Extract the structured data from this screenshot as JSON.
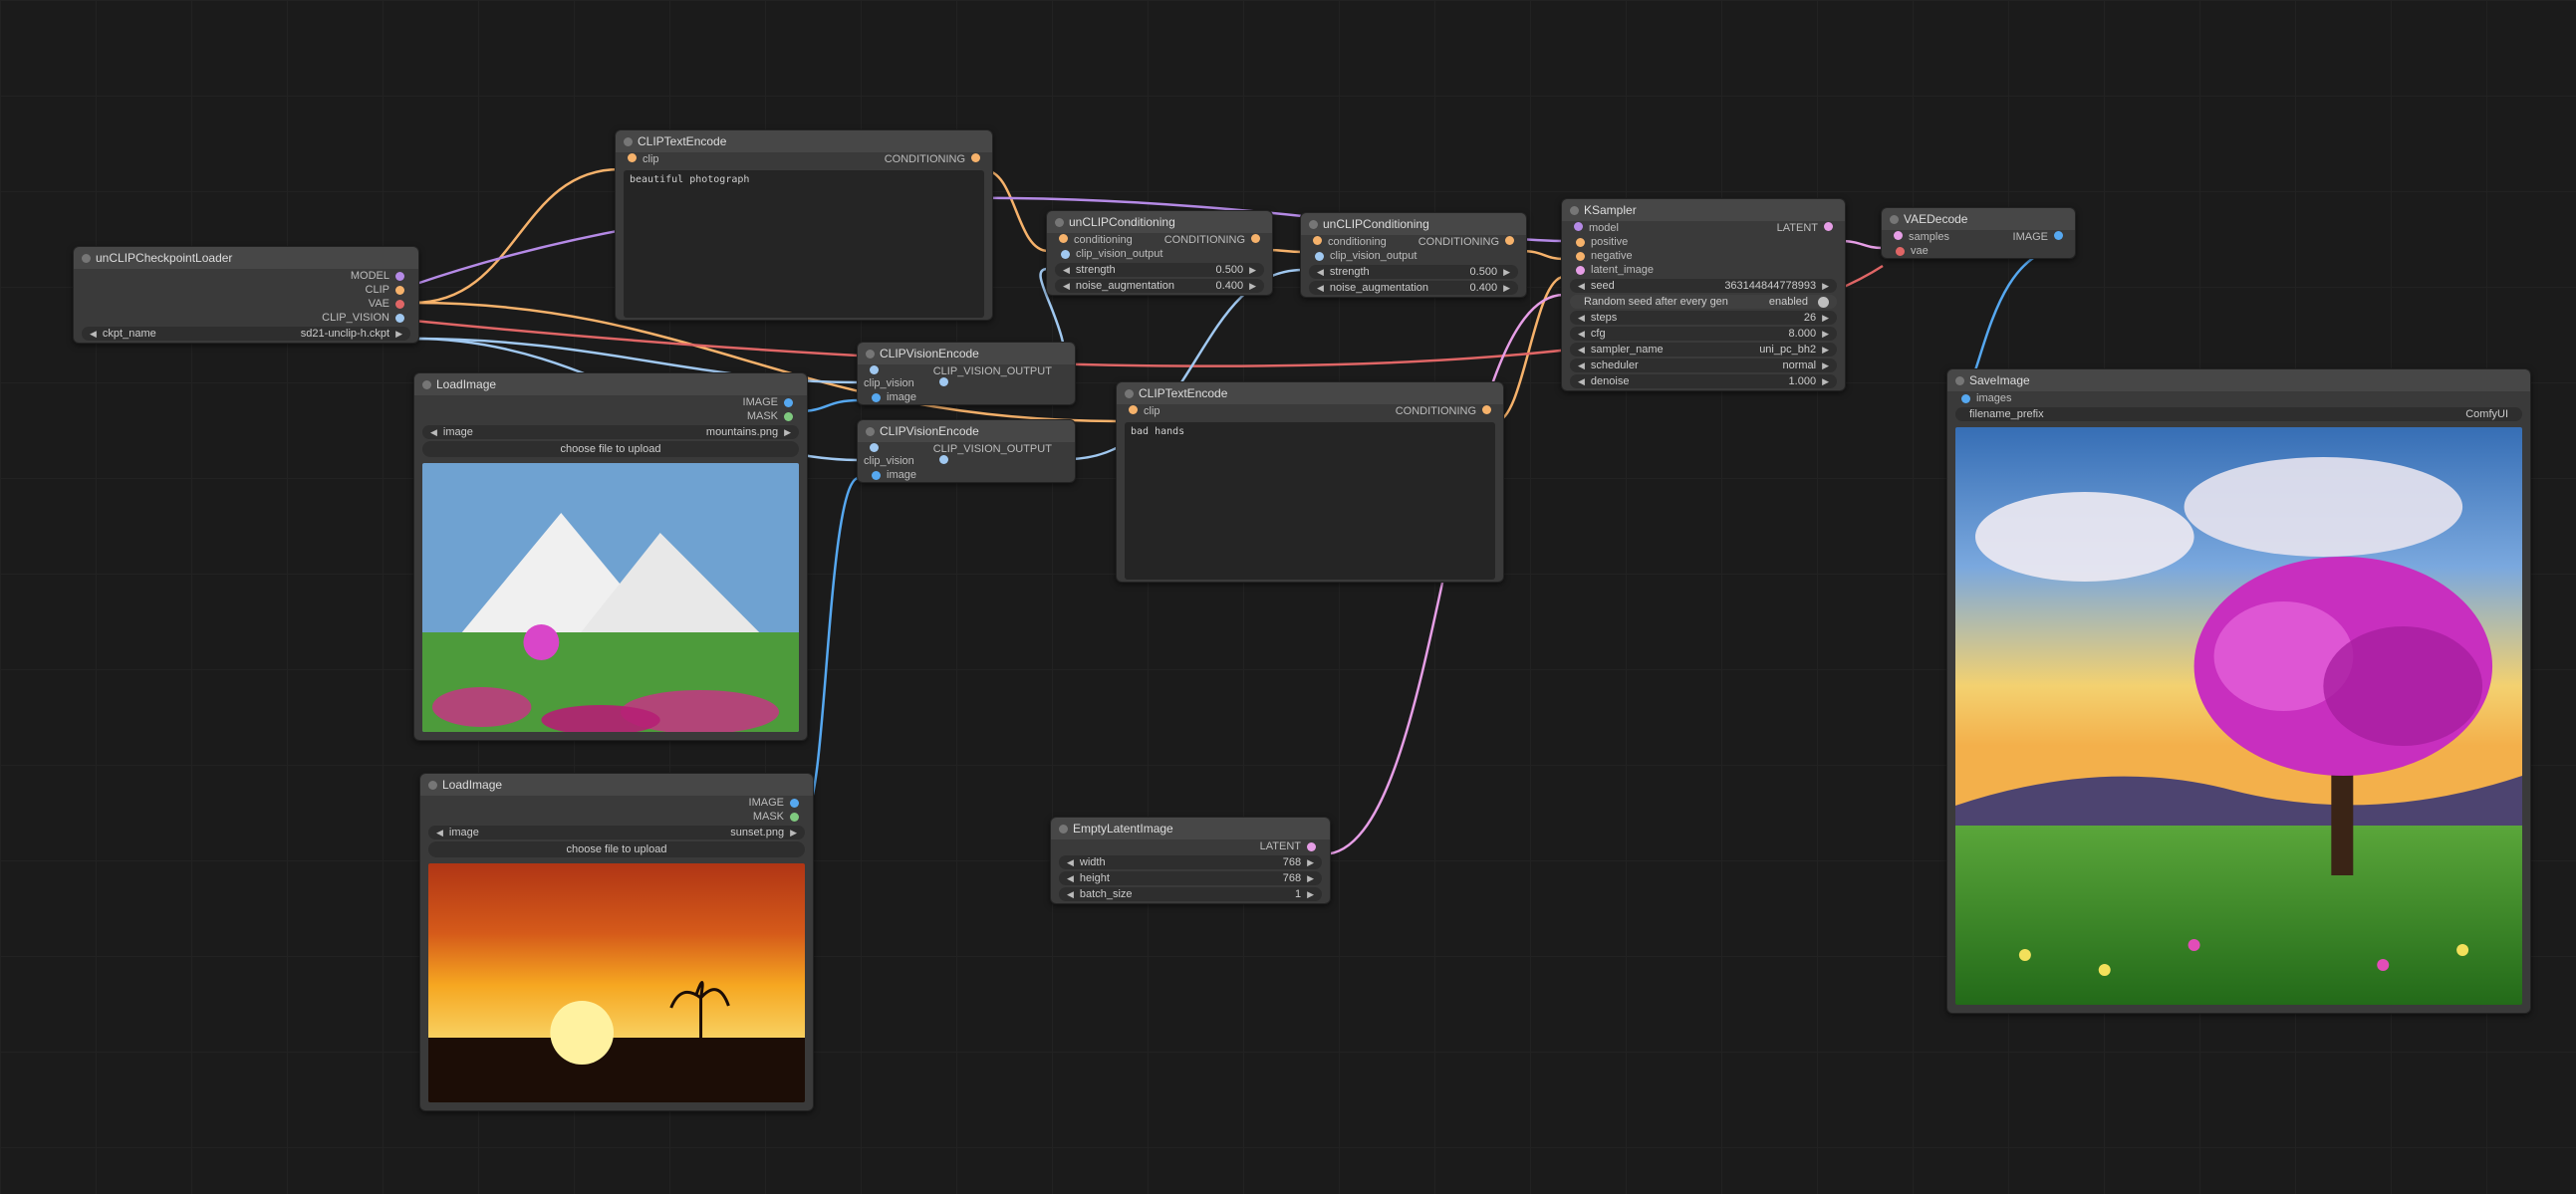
{
  "nodes": {
    "ckpt": {
      "title": "unCLIPCheckpointLoader",
      "outputs": [
        "MODEL",
        "CLIP",
        "VAE",
        "CLIP_VISION"
      ],
      "widgets": {
        "ckpt_name": {
          "label": "ckpt_name",
          "value": "sd21-unclip-h.ckpt"
        }
      }
    },
    "cliptext_pos": {
      "title": "CLIPTextEncode",
      "inputs": {
        "clip": "clip"
      },
      "outputs": [
        "CONDITIONING"
      ],
      "text": "beautiful photograph"
    },
    "cliptext_neg": {
      "title": "CLIPTextEncode",
      "inputs": {
        "clip": "clip"
      },
      "outputs": [
        "CONDITIONING"
      ],
      "text": "bad hands"
    },
    "loadimg1": {
      "title": "LoadImage",
      "outputs": [
        "IMAGE",
        "MASK"
      ],
      "widgets": {
        "image": {
          "label": "image",
          "value": "mountains.png"
        }
      },
      "button": "choose file to upload"
    },
    "loadimg2": {
      "title": "LoadImage",
      "outputs": [
        "IMAGE",
        "MASK"
      ],
      "widgets": {
        "image": {
          "label": "image",
          "value": "sunset.png"
        }
      },
      "button": "choose file to upload"
    },
    "clipvis1": {
      "title": "CLIPVisionEncode",
      "inputs": {
        "clip_vision": "clip_vision",
        "image": "image"
      },
      "outputs": [
        "CLIP_VISION_OUTPUT"
      ]
    },
    "clipvis2": {
      "title": "CLIPVisionEncode",
      "inputs": {
        "clip_vision": "clip_vision",
        "image": "image"
      },
      "outputs": [
        "CLIP_VISION_OUTPUT"
      ]
    },
    "unclip1": {
      "title": "unCLIPConditioning",
      "inputs": {
        "conditioning": "conditioning",
        "cvo": "clip_vision_output"
      },
      "outputs": [
        "CONDITIONING"
      ],
      "widgets": {
        "strength": {
          "label": "strength",
          "value": "0.500"
        },
        "noise_aug": {
          "label": "noise_augmentation",
          "value": "0.400"
        }
      }
    },
    "unclip2": {
      "title": "unCLIPConditioning",
      "inputs": {
        "conditioning": "conditioning",
        "cvo": "clip_vision_output"
      },
      "outputs": [
        "CONDITIONING"
      ],
      "widgets": {
        "strength": {
          "label": "strength",
          "value": "0.500"
        },
        "noise_aug": {
          "label": "noise_augmentation",
          "value": "0.400"
        }
      }
    },
    "ksampler": {
      "title": "KSampler",
      "inputs": {
        "model": "model",
        "positive": "positive",
        "negative": "negative",
        "latent_image": "latent_image"
      },
      "outputs": [
        "LATENT"
      ],
      "widgets": {
        "seed": {
          "label": "seed",
          "value": "363144844778993"
        },
        "random_seed_toggle": {
          "label": "Random seed after every gen",
          "value": "enabled"
        },
        "steps": {
          "label": "steps",
          "value": "26"
        },
        "cfg": {
          "label": "cfg",
          "value": "8.000"
        },
        "sampler_name": {
          "label": "sampler_name",
          "value": "uni_pc_bh2"
        },
        "scheduler": {
          "label": "scheduler",
          "value": "normal"
        },
        "denoise": {
          "label": "denoise",
          "value": "1.000"
        }
      }
    },
    "empty": {
      "title": "EmptyLatentImage",
      "outputs": [
        "LATENT"
      ],
      "widgets": {
        "width": {
          "label": "width",
          "value": "768"
        },
        "height": {
          "label": "height",
          "value": "768"
        },
        "batch_size": {
          "label": "batch_size",
          "value": "1"
        }
      }
    },
    "vaedecode": {
      "title": "VAEDecode",
      "inputs": {
        "samples": "samples",
        "vae": "vae"
      },
      "outputs": [
        "IMAGE"
      ]
    },
    "saveimg": {
      "title": "SaveImage",
      "inputs": {
        "images": "images"
      },
      "widgets": {
        "filename_prefix": {
          "label": "filename_prefix",
          "value": "ComfyUI"
        }
      }
    }
  }
}
